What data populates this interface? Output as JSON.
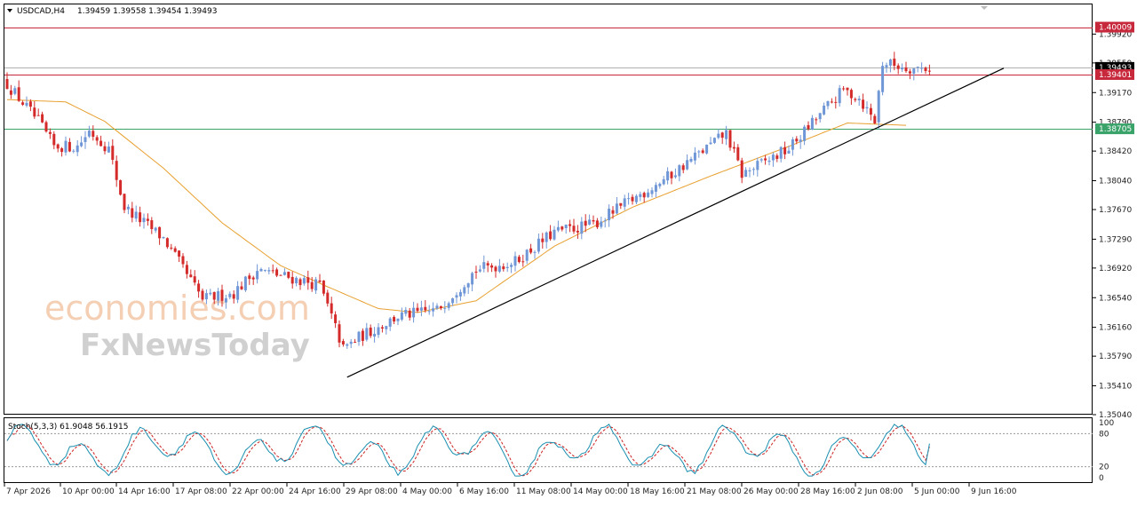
{
  "header": {
    "symbol": "USDCAD,H4",
    "ohlc": "1.39459 1.39558 1.39454 1.39493"
  },
  "watermark": {
    "line1": "economies.com",
    "line2": "FxNewsToday"
  },
  "stoch": {
    "label": "Stoch(5,3,3) 61.9048 56.1915",
    "levels": [
      100,
      80,
      20,
      0
    ],
    "level_labels": [
      "100",
      "80",
      "20",
      "0"
    ],
    "main_color": "#1a8fb0",
    "signal_color": "#cc2222"
  },
  "colors": {
    "bull": "#6f96d6",
    "bear": "#d42a2a",
    "ma": "#e8a030",
    "resistance": "#c8283c",
    "support": "#3aa36a",
    "trendline": "#000000"
  },
  "chart_data": {
    "type": "candlestick",
    "instrument": "USDCAD",
    "timeframe": "H4",
    "y_range": [
      1.3504,
      1.403
    ],
    "y_ticks": [
      "1.39920",
      "1.39550",
      "1.39170",
      "1.38790",
      "1.38420",
      "1.38040",
      "1.37670",
      "1.37290",
      "1.36920",
      "1.36540",
      "1.36160",
      "1.35790",
      "1.35410",
      "1.35040"
    ],
    "x_ticks": [
      "7 Apr 2026",
      "10 Apr 00:00",
      "14 Apr 16:00",
      "17 Apr 08:00",
      "22 Apr 00:00",
      "24 Apr 16:00",
      "29 Apr 08:00",
      "4 May 00:00",
      "6 May 16:00",
      "11 May 08:00",
      "14 May 00:00",
      "18 May 16:00",
      "21 May 08:00",
      "26 May 00:00",
      "28 May 16:00",
      "2 Jun 08:00",
      "5 Jun 00:00",
      "9 Jun 16:00"
    ],
    "levels": [
      {
        "name": "resistance",
        "value": 1.40009,
        "label": "1.40009"
      },
      {
        "name": "resistance",
        "value": 1.39401,
        "label": "1.39401"
      },
      {
        "name": "support",
        "value": 1.38705,
        "label": "1.38705"
      }
    ],
    "current_price": {
      "value": 1.39493,
      "label": "1.39493"
    },
    "trendline": {
      "from": {
        "candle": 87,
        "price": 1.3552
      },
      "to": {
        "candle": 232,
        "price": 1.3894
      }
    },
    "close_path": [
      [
        0,
        1.3928
      ],
      [
        8,
        1.388
      ],
      [
        12,
        1.3848
      ],
      [
        18,
        1.3848
      ],
      [
        21,
        1.3868
      ],
      [
        26,
        1.3845
      ],
      [
        30,
        1.377
      ],
      [
        40,
        1.373
      ],
      [
        50,
        1.3652
      ],
      [
        58,
        1.366
      ],
      [
        64,
        1.369
      ],
      [
        72,
        1.368
      ],
      [
        80,
        1.367
      ],
      [
        86,
        1.3588
      ],
      [
        90,
        1.3603
      ],
      [
        100,
        1.363
      ],
      [
        110,
        1.3638
      ],
      [
        120,
        1.369
      ],
      [
        130,
        1.37
      ],
      [
        140,
        1.3738
      ],
      [
        150,
        1.3748
      ],
      [
        160,
        1.378
      ],
      [
        170,
        1.3812
      ],
      [
        180,
        1.385
      ],
      [
        184,
        1.3865
      ],
      [
        188,
        1.3812
      ],
      [
        200,
        1.3845
      ],
      [
        210,
        1.39
      ],
      [
        214,
        1.392
      ],
      [
        218,
        1.391
      ],
      [
        222,
        1.388
      ],
      [
        224,
        1.3955
      ],
      [
        232,
        1.3948
      ],
      [
        236,
        1.3949
      ]
    ],
    "ma_path": [
      [
        0,
        1.3908
      ],
      [
        15,
        1.3905
      ],
      [
        25,
        1.388
      ],
      [
        40,
        1.382
      ],
      [
        55,
        1.375
      ],
      [
        70,
        1.3695
      ],
      [
        82,
        1.3668
      ],
      [
        95,
        1.364
      ],
      [
        105,
        1.3635
      ],
      [
        120,
        1.365
      ],
      [
        140,
        1.372
      ],
      [
        160,
        1.377
      ],
      [
        180,
        1.381
      ],
      [
        200,
        1.3848
      ],
      [
        215,
        1.3878
      ],
      [
        230,
        1.3875
      ]
    ]
  }
}
